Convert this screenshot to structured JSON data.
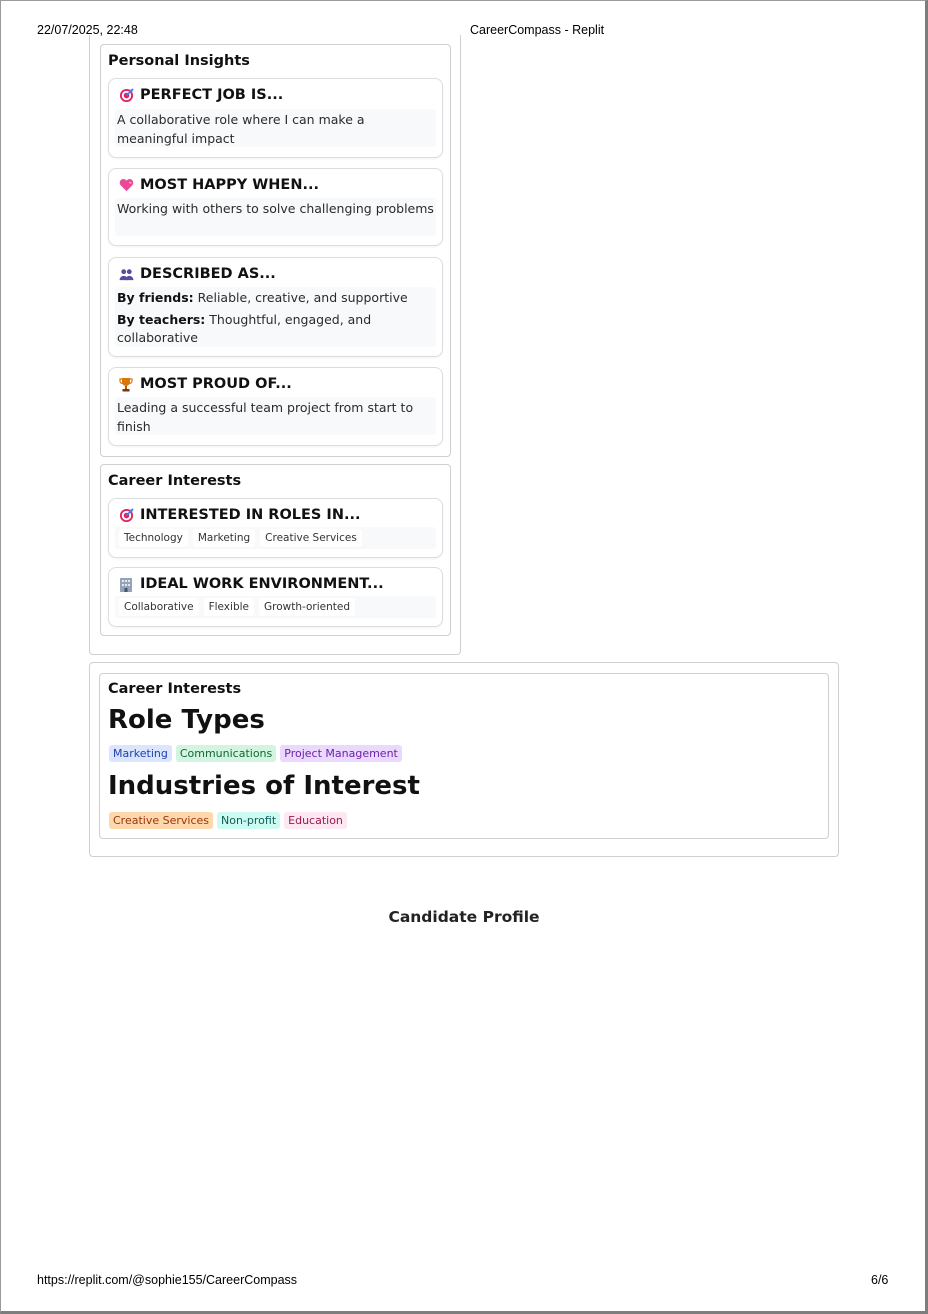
{
  "print_header": {
    "datetime": "22/07/2025, 22:48",
    "title": "CareerCompass - Replit"
  },
  "print_footer": {
    "url": "https://replit.com/@sophie155/CareerCompass",
    "page": "6/6"
  },
  "personal_insights": {
    "title": "Personal Insights",
    "items": [
      {
        "icon": "target-icon",
        "label": "PERFECT JOB IS...",
        "text": "A collaborative role where I can make a meaningful impact"
      },
      {
        "icon": "heart-icon",
        "label": "MOST HAPPY WHEN...",
        "text": "Working with others to solve challenging problems"
      },
      {
        "icon": "people-icon",
        "label": "DESCRIBED AS...",
        "lines": [
          {
            "prefix": "By friends:",
            "text": "Reliable, creative, and supportive"
          },
          {
            "prefix": "By teachers:",
            "text": "Thoughtful, engaged, and collaborative"
          }
        ]
      },
      {
        "icon": "trophy-icon",
        "label": "MOST PROUD OF...",
        "text": "Leading a successful team project from start to finish"
      }
    ]
  },
  "career_interests_small": {
    "title": "Career Interests",
    "roles": {
      "icon": "target-icon",
      "label": "INTERESTED IN ROLES IN...",
      "chips": [
        "Technology",
        "Marketing",
        "Creative Services"
      ]
    },
    "environment": {
      "icon": "office-building-icon",
      "label": "IDEAL WORK ENVIRONMENT...",
      "chips": [
        "Collaborative",
        "Flexible",
        "Growth-oriented"
      ]
    }
  },
  "career_interests_large": {
    "title": "Career Interests",
    "role_types_heading": "Role Types",
    "role_types": [
      {
        "label": "Marketing",
        "bg": "#dbe6fe",
        "fg": "#1e40af"
      },
      {
        "label": "Communications",
        "bg": "#d1f5e0",
        "fg": "#166534"
      },
      {
        "label": "Project Management",
        "bg": "#ead9fd",
        "fg": "#6b21a8"
      }
    ],
    "industries_heading": "Industries of Interest",
    "industries": [
      {
        "label": "Creative Services",
        "bg": "#fed7aa",
        "fg": "#9a3412"
      },
      {
        "label": "Non-profit",
        "bg": "#ccfbf1",
        "fg": "#115e59"
      },
      {
        "label": "Education",
        "bg": "#fce7f3",
        "fg": "#9d174d"
      }
    ]
  },
  "page_footer_title": "Candidate Profile"
}
